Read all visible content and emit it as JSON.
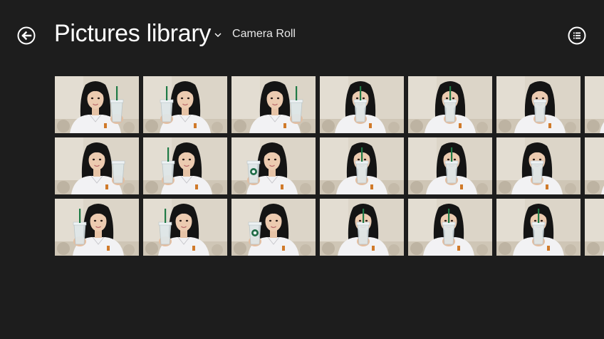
{
  "header": {
    "back_icon": "back-arrow-icon",
    "title": "Pictures library",
    "title_dropdown_icon": "chevron-down-icon",
    "subtitle": "Camera Roll",
    "view_icon": "list-view-icon"
  },
  "colors": {
    "background": "#1d1d1d",
    "text": "#ffffff"
  },
  "grid": {
    "rows": 3,
    "visible_columns": 7,
    "photos": [
      {
        "cup": "right",
        "straw": "green"
      },
      {
        "cup": "left",
        "straw": "green"
      },
      {
        "cup": "right",
        "straw": "green"
      },
      {
        "cup": "center",
        "straw": "green"
      },
      {
        "cup": "center",
        "straw": "green"
      },
      {
        "cup": "center",
        "straw": "none"
      },
      {
        "cup": "edge",
        "straw": "none"
      },
      {
        "cup": "right",
        "straw": "none"
      },
      {
        "cup": "left",
        "straw": "green"
      },
      {
        "cup": "left",
        "straw": "logo"
      },
      {
        "cup": "center",
        "straw": "green"
      },
      {
        "cup": "center",
        "straw": "green"
      },
      {
        "cup": "center",
        "straw": "none"
      },
      {
        "cup": "edge",
        "straw": "none"
      },
      {
        "cup": "left",
        "straw": "green"
      },
      {
        "cup": "left",
        "straw": "green"
      },
      {
        "cup": "left",
        "straw": "logo"
      },
      {
        "cup": "center",
        "straw": "green"
      },
      {
        "cup": "center",
        "straw": "green"
      },
      {
        "cup": "center",
        "straw": "green"
      },
      {
        "cup": "edge",
        "straw": "none"
      }
    ]
  }
}
